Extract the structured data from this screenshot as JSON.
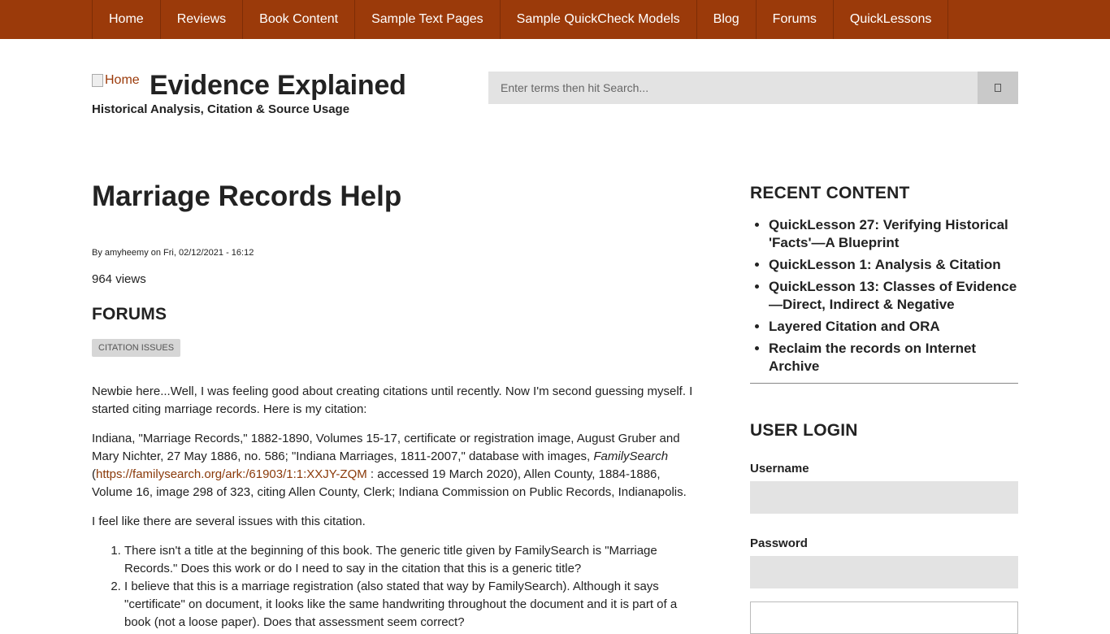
{
  "nav": {
    "items": [
      "Home",
      "Reviews",
      "Book Content",
      "Sample Text Pages",
      "Sample QuickCheck Models",
      "Blog",
      "Forums",
      "QuickLessons"
    ]
  },
  "branding": {
    "logo_alt": "Home",
    "site_name": "Evidence Explained",
    "slogan": "Historical Analysis, Citation & Source Usage"
  },
  "search": {
    "placeholder": "Enter terms then hit Search..."
  },
  "article": {
    "title": "Marriage Records Help",
    "submitted": "By amyheemy on Fri, 02/12/2021 - 16:12",
    "views": "964 views",
    "forums_heading": "FORUMS",
    "tag": "CITATION ISSUES",
    "p1": "Newbie here...Well, I was feeling good about creating citations until recently. Now I'm second guessing myself. I started citing marriage records. Here is my citation:",
    "p2_a": "Indiana, \"Marriage Records,\" 1882-1890, Volumes 15-17, certificate or registration image, August Gruber and Mary Nichter, 27 May 1886, no. 586; \"Indiana Marriages, 1811-2007,\" database with images, ",
    "p2_em": "FamilySearch",
    "p2_b": " (",
    "p2_link": "https://familysearch.org/ark:/61903/1:1:XXJY-ZQM",
    "p2_c": " : accessed 19 March 2020), Allen County, 1884-1886, Volume 16, image 298 of 323, citing Allen County, Clerk; Indiana Commission on Public Records, Indianapolis.",
    "p3": "I feel like there are several issues with this citation.",
    "list": [
      "There isn't a title at the beginning of this book. The generic title given by FamilySearch is \"Marriage Records.\" Does this work or do I need to say in the citation that this is a generic title?",
      "I believe that this is a marriage registration (also stated that way by FamilySearch). Although it says \"certificate\" on document, it looks like the same handwriting throughout the document and it is part of a book (not a loose paper). Does that assessment seem correct?"
    ]
  },
  "sidebar": {
    "recent_heading": "RECENT CONTENT",
    "recent_items": [
      "QuickLesson 27: Verifying Historical 'Facts'—A Blueprint",
      "QuickLesson 1: Analysis & Citation",
      "QuickLesson 13: Classes of Evidence—Direct, Indirect & Negative",
      "Layered Citation and ORA",
      "Reclaim the records on Internet Archive"
    ],
    "login_heading": "USER LOGIN",
    "username_label": "Username",
    "password_label": "Password"
  },
  "colors": {
    "nav_bg": "#9b3a0a",
    "link": "#8a3a0a",
    "field_bg": "#e3e3e3"
  }
}
